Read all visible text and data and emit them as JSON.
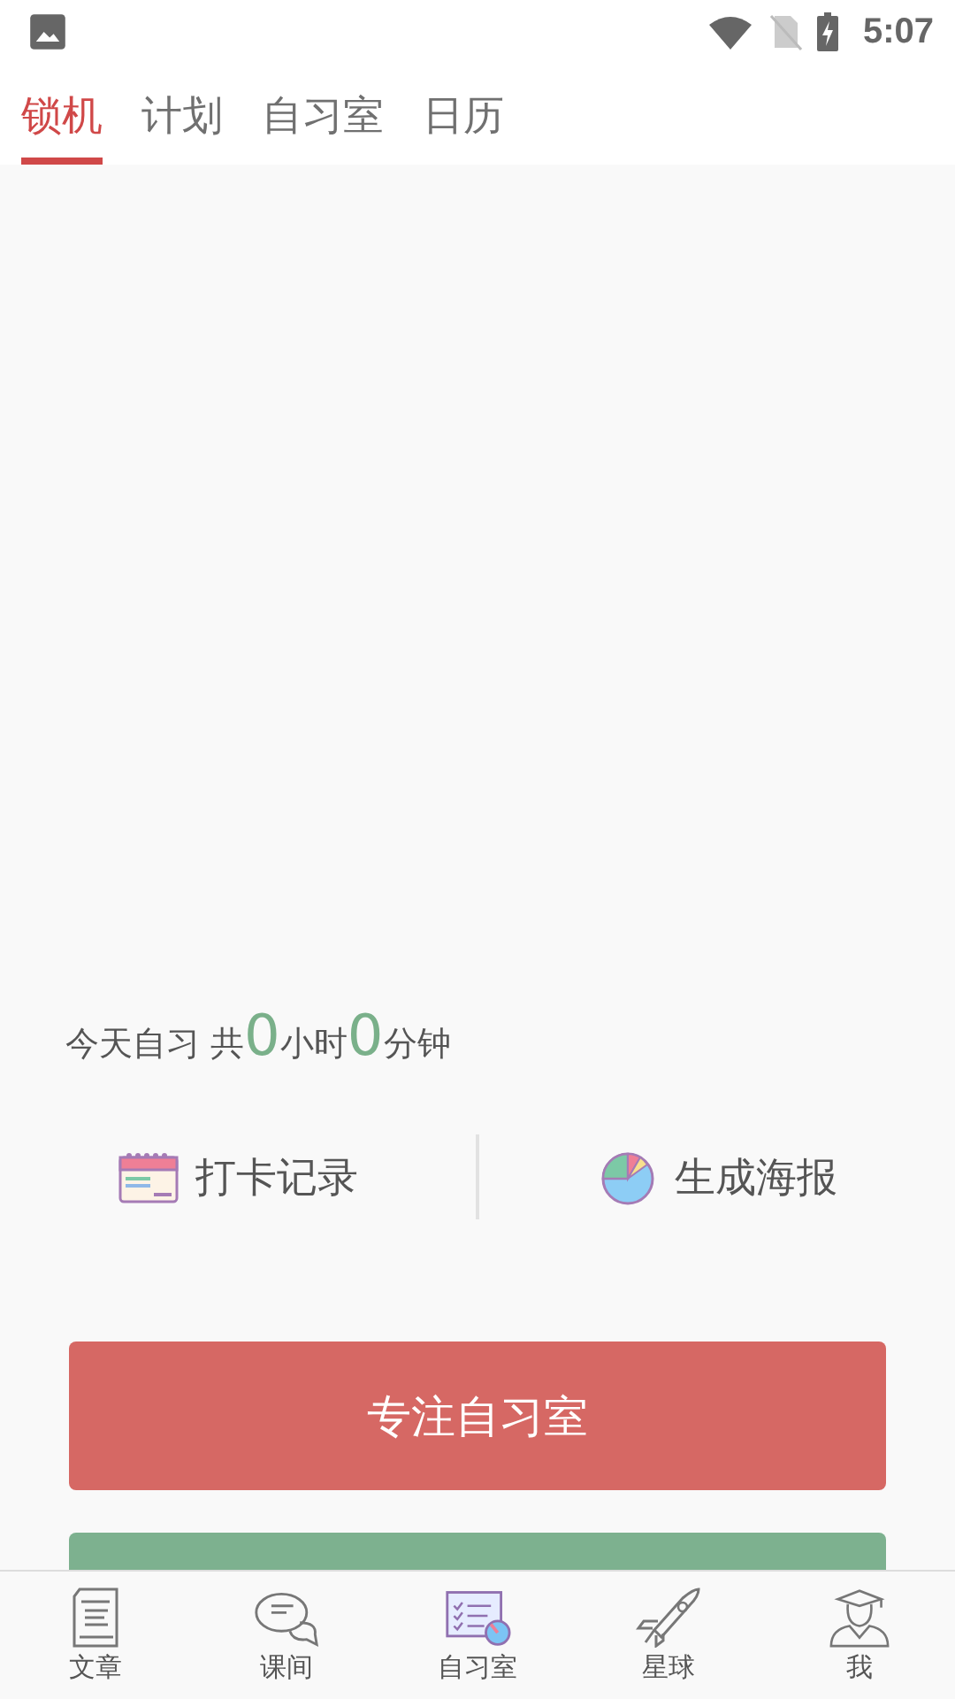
{
  "status_bar": {
    "time": "5:07"
  },
  "tabs": [
    {
      "label": "锁机",
      "selected": true
    },
    {
      "label": "计划",
      "selected": false
    },
    {
      "label": "自习室",
      "selected": false
    },
    {
      "label": "日历",
      "selected": false
    }
  ],
  "summary": {
    "prefix": "今天自习 共",
    "hours": "0",
    "hours_unit": "小时",
    "minutes": "0",
    "minutes_unit": "分钟"
  },
  "actions": [
    {
      "kind": "calendar",
      "label": "打卡记录"
    },
    {
      "kind": "chart",
      "label": "生成海报"
    }
  ],
  "primary_button": "专注自习室",
  "bottom_nav": [
    {
      "kind": "document",
      "label": "文章",
      "selected": false
    },
    {
      "kind": "chat",
      "label": "课间",
      "selected": false
    },
    {
      "kind": "checklist",
      "label": "自习室",
      "selected": true
    },
    {
      "kind": "rocket",
      "label": "星球",
      "selected": false
    },
    {
      "kind": "graduate",
      "label": "我",
      "selected": false
    }
  ]
}
